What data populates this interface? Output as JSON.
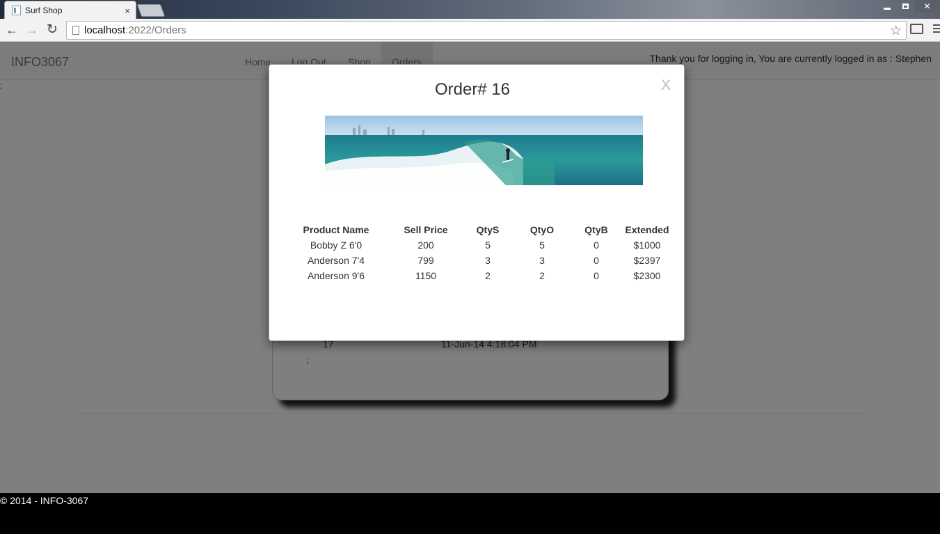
{
  "browser": {
    "tab_title": "Surf Shop",
    "tab_close": "×",
    "url_host": "localhost",
    "url_path": ":2022/Orders",
    "icons": {
      "back": "back-arrow-icon",
      "forward": "forward-arrow-icon",
      "reload": "reload-icon",
      "page": "page-icon",
      "star": "bookmark-star-icon",
      "cast": "cast-icon",
      "menu": "menu-icon"
    }
  },
  "navbar": {
    "brand": "INFO3067",
    "links": [
      "Home",
      "Log Out",
      "Shop",
      "Orders"
    ],
    "logged_in_text": "Thank you for logging in, You are currently logged in as : Stephen"
  },
  "page": {
    "semicolon_top": ";",
    "order_row": {
      "id": "17",
      "date": "11-Jun-14 4:18:04 PM"
    },
    "semicolon_card": ";"
  },
  "modal": {
    "title": "Order# 16",
    "close": "X",
    "columns": [
      "Product Name",
      "Sell Price",
      "QtyS",
      "QtyO",
      "QtyB",
      "Extended"
    ],
    "rows": [
      [
        "Bobby Z 6'0",
        "200",
        "5",
        "5",
        "0",
        "$1000"
      ],
      [
        "Anderson 7'4",
        "799",
        "3",
        "3",
        "0",
        "$2397"
      ],
      [
        "Anderson 9'6",
        "1150",
        "2",
        "2",
        "0",
        "$2300"
      ]
    ]
  },
  "footer": {
    "text": "© 2014 - INFO-3067"
  },
  "colors": {
    "navbar_bg": "#f8f8f8",
    "overlay": "rgba(0,0,0,0.5)",
    "footer_bg": "#000000"
  }
}
